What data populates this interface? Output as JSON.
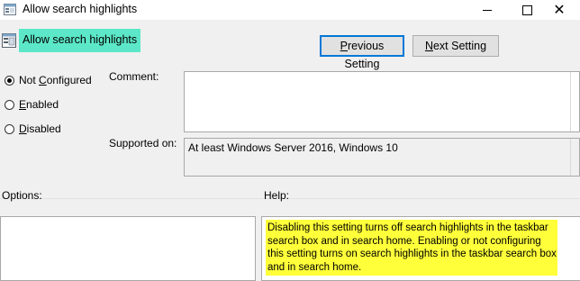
{
  "window": {
    "title": "Allow search highlights",
    "controls": {
      "minimize": "minimize-icon",
      "maximize": "maximize-icon",
      "close": "close-icon"
    }
  },
  "header": {
    "policy_name": "Allow search highlights",
    "highlight_color": "#5ce8c8",
    "icon": "policy-setting-icon"
  },
  "nav": {
    "previous_pre": "",
    "previous_accel": "P",
    "previous_post": "revious Setting",
    "next_pre": "",
    "next_accel": "N",
    "next_post": "ext Setting"
  },
  "state": {
    "selected": "Not Configured",
    "options": [
      {
        "pre": "Not ",
        "accel": "C",
        "post": "onfigured"
      },
      {
        "pre": "",
        "accel": "E",
        "post": "nabled"
      },
      {
        "pre": "",
        "accel": "D",
        "post": "isabled"
      }
    ]
  },
  "fields": {
    "comment_label": "Comment:",
    "comment_value": "",
    "supported_label": "Supported on:",
    "supported_value": "At least Windows Server 2016, Windows 10"
  },
  "panes": {
    "options_label": "Options:",
    "help_label": "Help:",
    "help_text": "Disabling this setting turns off search highlights in the taskbar search box and in search home. Enabling or not configuring this setting turns on search highlights in the taskbar search box and in search home.",
    "help_highlight_color": "#ffff3a"
  }
}
